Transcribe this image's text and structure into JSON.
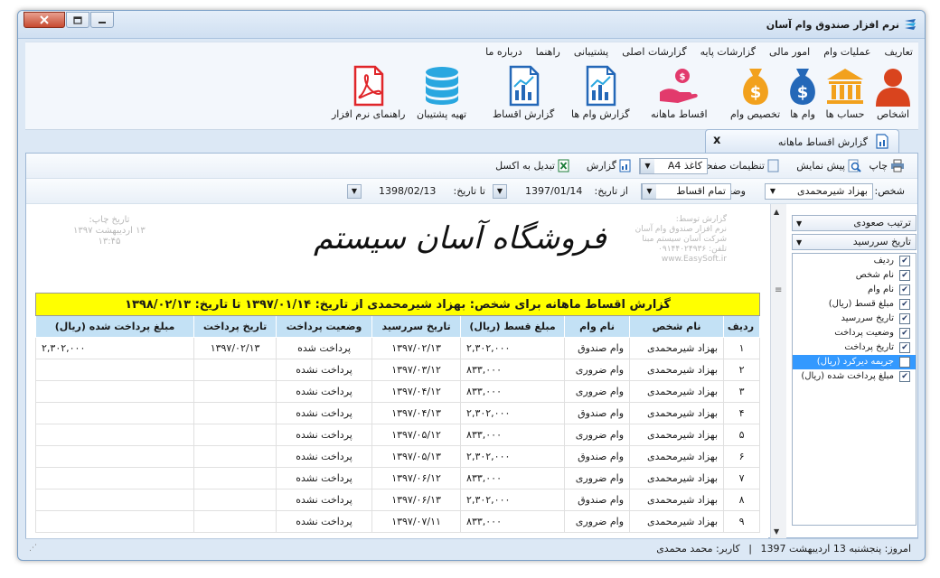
{
  "window": {
    "title": "نرم افزار صندوق وام آسان"
  },
  "menu": [
    "تعاریف",
    "عملیات وام",
    "امور مالی",
    "گزارشات پایه",
    "گزارشات اصلی",
    "پشتیبانی",
    "راهنما",
    "درباره ما"
  ],
  "ribbon": [
    {
      "label": "اشخاص",
      "icon": "person-icon",
      "color": "#d9441e"
    },
    {
      "label": "حساب ها",
      "icon": "bank-icon",
      "color": "#f2a11d"
    },
    {
      "label": "وام ها",
      "icon": "money-bag-blue-icon",
      "color": "#2468b8"
    },
    {
      "label": "تخصیص وام",
      "icon": "money-bag-orange-icon",
      "color": "#f2a11d"
    },
    {
      "label": "اقساط ماهانه",
      "icon": "hand-coin-icon",
      "color": "#e23a6c"
    },
    {
      "label": "گزارش وام ها",
      "icon": "report-chart-icon",
      "color": "#2468b8"
    },
    {
      "label": "گزارش اقساط",
      "icon": "report-chart-icon",
      "color": "#2468b8"
    },
    {
      "label": "تهیه پشتیبان",
      "icon": "database-icon",
      "color": "#29a7e0"
    },
    {
      "label": "راهنمای نرم افزار",
      "icon": "pdf-icon",
      "color": "#e0262a"
    }
  ],
  "tab": {
    "label": "گزارش اقساط ماهانه",
    "close": "x"
  },
  "toolbar": {
    "print": "چاپ",
    "preview": "پیش نمایش",
    "page_settings": "تنظیمات صفحه",
    "paper_size": "کاغذ A4",
    "report": "گزارش",
    "excel": "تبدیل به اکسل"
  },
  "filters": {
    "person_label": "شخص:",
    "person_value": "بهزاد شیرمحمدی",
    "status_label": "وضعیت:",
    "status_value": "تمام اقساط",
    "from_label": "از تاریخ:",
    "from_value": "1397/01/14",
    "to_label": "تا تاریخ:",
    "to_value": "1398/02/13"
  },
  "report": {
    "store_name": "فروشگاه آسان سیستم",
    "print_date_label": "تاریخ چاپ:",
    "print_date": "۱۳ اردیبهشت ۱۳۹۷",
    "print_time": "۱۳:۴۵",
    "made_by": "گزارش توسط:",
    "software": "نرم افزار صندوق وام آسان",
    "company": "شرکت آسان سیستم مبنا",
    "phone": "تلفن: ۰۹۱۴۴۰۲۴۹۳۶",
    "website": "www.EasySoft.ir",
    "caption": "گزارش اقساط ماهانه برای شخص: بهزاد شیرمحمدی از تاریخ: ۱۳۹۷/۰۱/۱۴ تا تاریخ: ۱۳۹۸/۰۲/۱۳",
    "columns": [
      "ردیف",
      "نام شخص",
      "نام وام",
      "مبلغ قسط (ریال)",
      "تاریخ سررسید",
      "وضعیت پرداخت",
      "تاریخ پرداخت",
      "مبلغ پرداخت شده (ریال)"
    ],
    "rows": [
      [
        "۱",
        "بهزاد شیرمحمدی",
        "وام صندوق",
        "۲,۳۰۲,۰۰۰",
        "۱۳۹۷/۰۲/۱۳",
        "پرداخت شده",
        "۱۳۹۷/۰۲/۱۳",
        "۲,۳۰۲,۰۰۰"
      ],
      [
        "۲",
        "بهزاد شیرمحمدی",
        "وام ضروری",
        "۸۳۳,۰۰۰",
        "۱۳۹۷/۰۳/۱۲",
        "پرداخت نشده",
        "",
        ""
      ],
      [
        "۳",
        "بهزاد شیرمحمدی",
        "وام ضروری",
        "۸۳۳,۰۰۰",
        "۱۳۹۷/۰۴/۱۲",
        "پرداخت نشده",
        "",
        ""
      ],
      [
        "۴",
        "بهزاد شیرمحمدی",
        "وام صندوق",
        "۲,۳۰۲,۰۰۰",
        "۱۳۹۷/۰۴/۱۳",
        "پرداخت نشده",
        "",
        ""
      ],
      [
        "۵",
        "بهزاد شیرمحمدی",
        "وام ضروری",
        "۸۳۳,۰۰۰",
        "۱۳۹۷/۰۵/۱۲",
        "پرداخت نشده",
        "",
        ""
      ],
      [
        "۶",
        "بهزاد شیرمحمدی",
        "وام صندوق",
        "۲,۳۰۲,۰۰۰",
        "۱۳۹۷/۰۵/۱۳",
        "پرداخت نشده",
        "",
        ""
      ],
      [
        "۷",
        "بهزاد شیرمحمدی",
        "وام ضروری",
        "۸۳۳,۰۰۰",
        "۱۳۹۷/۰۶/۱۲",
        "پرداخت نشده",
        "",
        ""
      ],
      [
        "۸",
        "بهزاد شیرمحمدی",
        "وام صندوق",
        "۲,۳۰۲,۰۰۰",
        "۱۳۹۷/۰۶/۱۳",
        "پرداخت نشده",
        "",
        ""
      ],
      [
        "۹",
        "بهزاد شیرمحمدی",
        "وام ضروری",
        "۸۳۳,۰۰۰",
        "۱۳۹۷/۰۷/۱۱",
        "پرداخت نشده",
        "",
        ""
      ]
    ]
  },
  "sidebar": {
    "sort_order": "ترتیب صعودی",
    "sort_field": "تاریخ سررسید",
    "columns": [
      {
        "label": "ردیف",
        "checked": true
      },
      {
        "label": "نام شخص",
        "checked": true
      },
      {
        "label": "نام وام",
        "checked": true
      },
      {
        "label": "مبلغ قسط (ریال)",
        "checked": true
      },
      {
        "label": "تاریخ سررسید",
        "checked": true
      },
      {
        "label": "وضعیت پرداخت",
        "checked": true
      },
      {
        "label": "تاریخ پرداخت",
        "checked": true
      },
      {
        "label": "جریمه دیرکرد (ریال)",
        "checked": false,
        "selected": true
      },
      {
        "label": "مبلغ پرداخت شده (ریال)",
        "checked": true
      }
    ]
  },
  "status": {
    "today": "امروز: پنجشنبه 13 اردیبهشت 1397",
    "separator": "|",
    "user": "کاربر: محمد محمدی"
  }
}
